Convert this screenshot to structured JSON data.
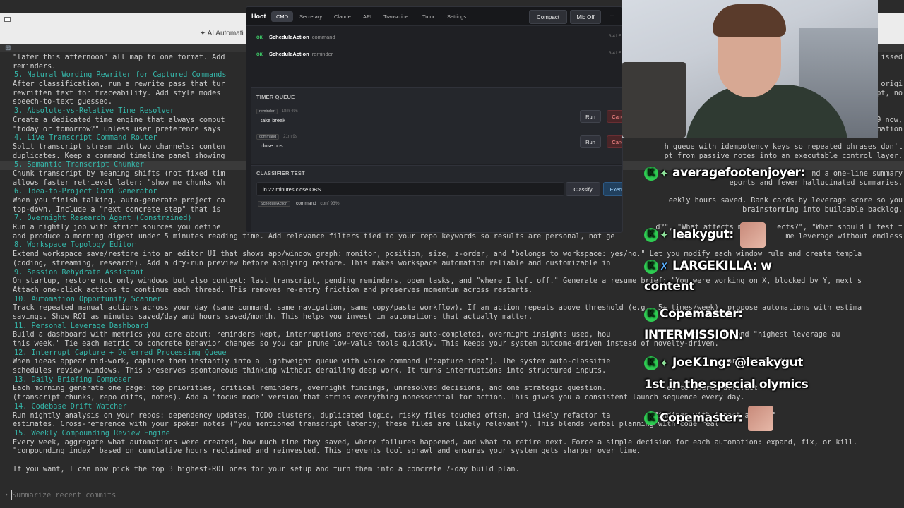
{
  "terminal": {
    "window_title": "✦ AI Automati",
    "prompt_placeholder": "Summarize recent commits",
    "lines": [
      {
        "t": "text",
        "v": "\"later this afternoon\" all map to one format. Add"
      },
      {
        "t": "text",
        "v": "reminders."
      },
      {
        "t": "head",
        "v": "5. Natural Wording Rewriter for Captured Commands"
      },
      {
        "t": "text",
        "v": "After classification, run a rewrite pass that tur"
      },
      {
        "t": "text",
        "v": "rewritten text for traceability. Add style modes"
      },
      {
        "t": "text",
        "v": "speech-to-text guessed."
      },
      {
        "t": "head",
        "v": "3. Absolute-vs-Relative Time Resolver"
      },
      {
        "t": "text",
        "v": "Create a dedicated time engine that always comput"
      },
      {
        "t": "text",
        "v": "\"today or tomorrow?\" unless user preference says"
      },
      {
        "t": "head",
        "v": "4. Live Transcript Command Router"
      },
      {
        "t": "text",
        "v": "Split transcript stream into two channels: conten"
      },
      {
        "t": "text",
        "v": "duplicates. Keep a command timeline panel showing"
      },
      {
        "t": "hl",
        "v": "5. Semantic Transcript Chunker"
      },
      {
        "t": "text",
        "v": "Chunk transcript by meaning shifts (not fixed tim"
      },
      {
        "t": "text",
        "v": "allows faster retrieval later: \"show me chunks wh"
      },
      {
        "t": "head",
        "v": "6. Idea-to-Project Card Generator"
      },
      {
        "t": "text",
        "v": "When you finish talking, auto-generate project ca"
      },
      {
        "t": "text",
        "v": "top-down. Include a \"next concrete step\" that is"
      },
      {
        "t": "head",
        "v": "7. Overnight Research Agent (Constrained)"
      },
      {
        "t": "text",
        "v": "Run a nightly job with strict sources you define"
      },
      {
        "t": "text",
        "v": "and produce a morning digest under 5 minutes reading time. Add relevance filters tied to your repo keywords so results are personal, not ge"
      },
      {
        "t": "head",
        "v": "8. Workspace Topology Editor"
      },
      {
        "t": "text",
        "v": "Extend workspace save/restore into an editor UI that shows app/window graph: monitor, position, size, z-order, and \"belongs to workspace: yes/no.\" Let you modify each window rule and create templa"
      },
      {
        "t": "text",
        "v": "(coding, streaming, research). Add a dry-run preview before applying restore. This makes workspace automation reliable and customizable in"
      },
      {
        "t": "head",
        "v": "9. Session Rehydrate Assistant"
      },
      {
        "t": "text",
        "v": "On startup, restore not only windows but also context: last transcript, pending reminders, open tasks, and \"where I left off.\" Generate a resume brief: \"You were working on X, blocked by Y, next s"
      },
      {
        "t": "text",
        "v": "Attach one-click actions to continue each thread. This removes re-entry friction and preserves momentum across restarts."
      },
      {
        "t": "head",
        "v": "10. Automation Opportunity Scanner"
      },
      {
        "t": "text",
        "v": "Track repeated manual actions across your day (same command, same navigation, same copy/paste workflow). If an action repeats above threshold (e.g., 5+ times/week), propose automations with estima"
      },
      {
        "t": "text",
        "v": "savings. Show ROI as minutes saved/day and hours saved/month. This helps you invest in automations that actually matter."
      },
      {
        "t": "head",
        "v": "11. Personal Leverage Dashboard"
      },
      {
        "t": "text",
        "v": "Build a dashboard with metrics you care about: reminders kept, interruptions prevented, tasks auto-completed, overnight insights used, hou                 trend lines and \"highest leverage au"
      },
      {
        "t": "text",
        "v": "this week.\" Tie each metric to concrete behavior changes so you can prune low-value tools quickly. This keeps your system outcome-driven instead of novelty-driven."
      },
      {
        "t": "head",
        "v": "12. Interrupt Capture + Deferred Processing Queue"
      },
      {
        "t": "text",
        "v": "When ideas appear mid-work, capture them instantly into a lightweight queue with voice command (\"capture idea\"). The system auto-classifie                         , or discard, the"
      },
      {
        "t": "text",
        "v": "schedules review windows. This preserves spontaneous thinking without derailing deep work. It turns interruptions into structured inputs."
      },
      {
        "t": "head",
        "v": "13. Daily Briefing Composer"
      },
      {
        "t": "text",
        "v": "Each morning generate one page: top priorities, critical reminders, overnight findings, unresolved decisions, and one strategic question.              ed to source artifact"
      },
      {
        "t": "text",
        "v": "(transcript chunks, repo diffs, notes). Add a \"focus mode\" version that strips everything nonessential for action. This gives you a consistent launch sequence every day."
      },
      {
        "t": "head",
        "v": "14. Codebase Drift Watcher"
      },
      {
        "t": "text",
        "v": "Run nightly analysis on your repos: dependency updates, TODO clusters, duplicated logic, risky files touched often, and likely refactor ta          findings with impact and eff"
      },
      {
        "t": "text",
        "v": "estimates. Cross-reference with your spoken notes (\"you mentioned transcript latency; these files are likely relevant\"). This blends verbal planning with code real"
      },
      {
        "t": "head",
        "v": "15. Weekly Compounding Review Engine"
      },
      {
        "t": "text",
        "v": "Every week, aggregate what automations were created, how much time they saved, where failures happened, and what to retire next. Force a simple decision for each automation: expand, fix, or kill."
      },
      {
        "t": "text",
        "v": "\"compounding index\" based on cumulative hours reclaimed and reinvested. This prevents tool sprawl and ensures your system gets sharper over time."
      },
      {
        "t": "blank",
        "v": ""
      },
      {
        "t": "plain",
        "v": "If you want, I can now pick the top 3 highest-ROI ones for your setup and turn them into a concrete 7-day build plan."
      }
    ],
    "right_fragments": [
      {
        "v": "issed",
        "row": 0
      },
      {
        "v": "h origi",
        "row": 3
      },
      {
        "v": "mpt, no",
        "row": 4
      },
      {
        "v": "9 now,",
        "row": 7
      },
      {
        "v": "rmation",
        "row": 8
      },
      {
        "v": "h queue with idempotency keys so repeated phrases don't",
        "row": 10
      },
      {
        "v": "pt from passive notes into an executable control layer.",
        "row": 11
      },
      {
        "v": "nd a one-line summary",
        "row": 13
      },
      {
        "v": "eports and fewer hallucinated summaries.",
        "row": 14
      },
      {
        "v": "eekly hours saved. Rank cards by leverage score so you",
        "row": 16
      },
      {
        "v": "brainstorming into buildable backlog.",
        "row": 17
      },
      {
        "v": "d?\", \"What affects m        ects?\", \"What should I test t",
        "row": 19
      },
      {
        "v": "                         me leverage without endless",
        "row": 20
      }
    ]
  },
  "hoot": {
    "brand": "Hoot",
    "tabs": [
      "CMD",
      "Secretary",
      "Claude",
      "API",
      "Transcribe",
      "Tutor",
      "Settings"
    ],
    "active_tab": "CMD",
    "compact_label": "Compact",
    "mic_label": "Mic Off",
    "close_glyph": "–",
    "log": [
      {
        "status": "OK",
        "action": "ScheduleAction",
        "kind": "command",
        "time": "3:41:5"
      },
      {
        "status": "OK",
        "action": "ScheduleAction",
        "kind": "reminder",
        "time": "3:41:5"
      }
    ],
    "timer_queue": {
      "title": "TIMER QUEUE",
      "items": [
        {
          "tag": "reminder",
          "remaining": "18m 49s",
          "name": "take break",
          "run": "Run",
          "cancel": "Cancel"
        },
        {
          "tag": "command",
          "remaining": "21m 9s",
          "name": "close obs",
          "run": "Run",
          "cancel": "Cancel"
        }
      ]
    },
    "classifier": {
      "title": "CLASSIFIER TEST",
      "input_value": "in 22 minutes close OBS",
      "classify_label": "Classify",
      "execute_label": "Execute",
      "result_tag": "ScheduleAction",
      "result_type": "command",
      "result_conf": "conf 93%"
    }
  },
  "chat": [
    {
      "user": "averagefootenjoyer:",
      "text": ""
    },
    {
      "user": "leakygut:",
      "text": ""
    },
    {
      "user": "LARGEKILLA:",
      "text": "w"
    },
    {
      "user": "",
      "text": "content"
    },
    {
      "user": "Copemaster:",
      "text": ""
    },
    {
      "user": "",
      "text": "INTERMISSION."
    },
    {
      "user": "JoeK1ng:",
      "text": "@leakygut"
    },
    {
      "user": "",
      "text": "1st in the special olymics"
    },
    {
      "user": "Copemaster:",
      "text": ""
    }
  ],
  "colors": {
    "accent_teal": "#35b7aa",
    "ok_green": "#3fd36b",
    "cancel_red": "#ff8b8b",
    "chat_badge": "#2ecc52"
  }
}
